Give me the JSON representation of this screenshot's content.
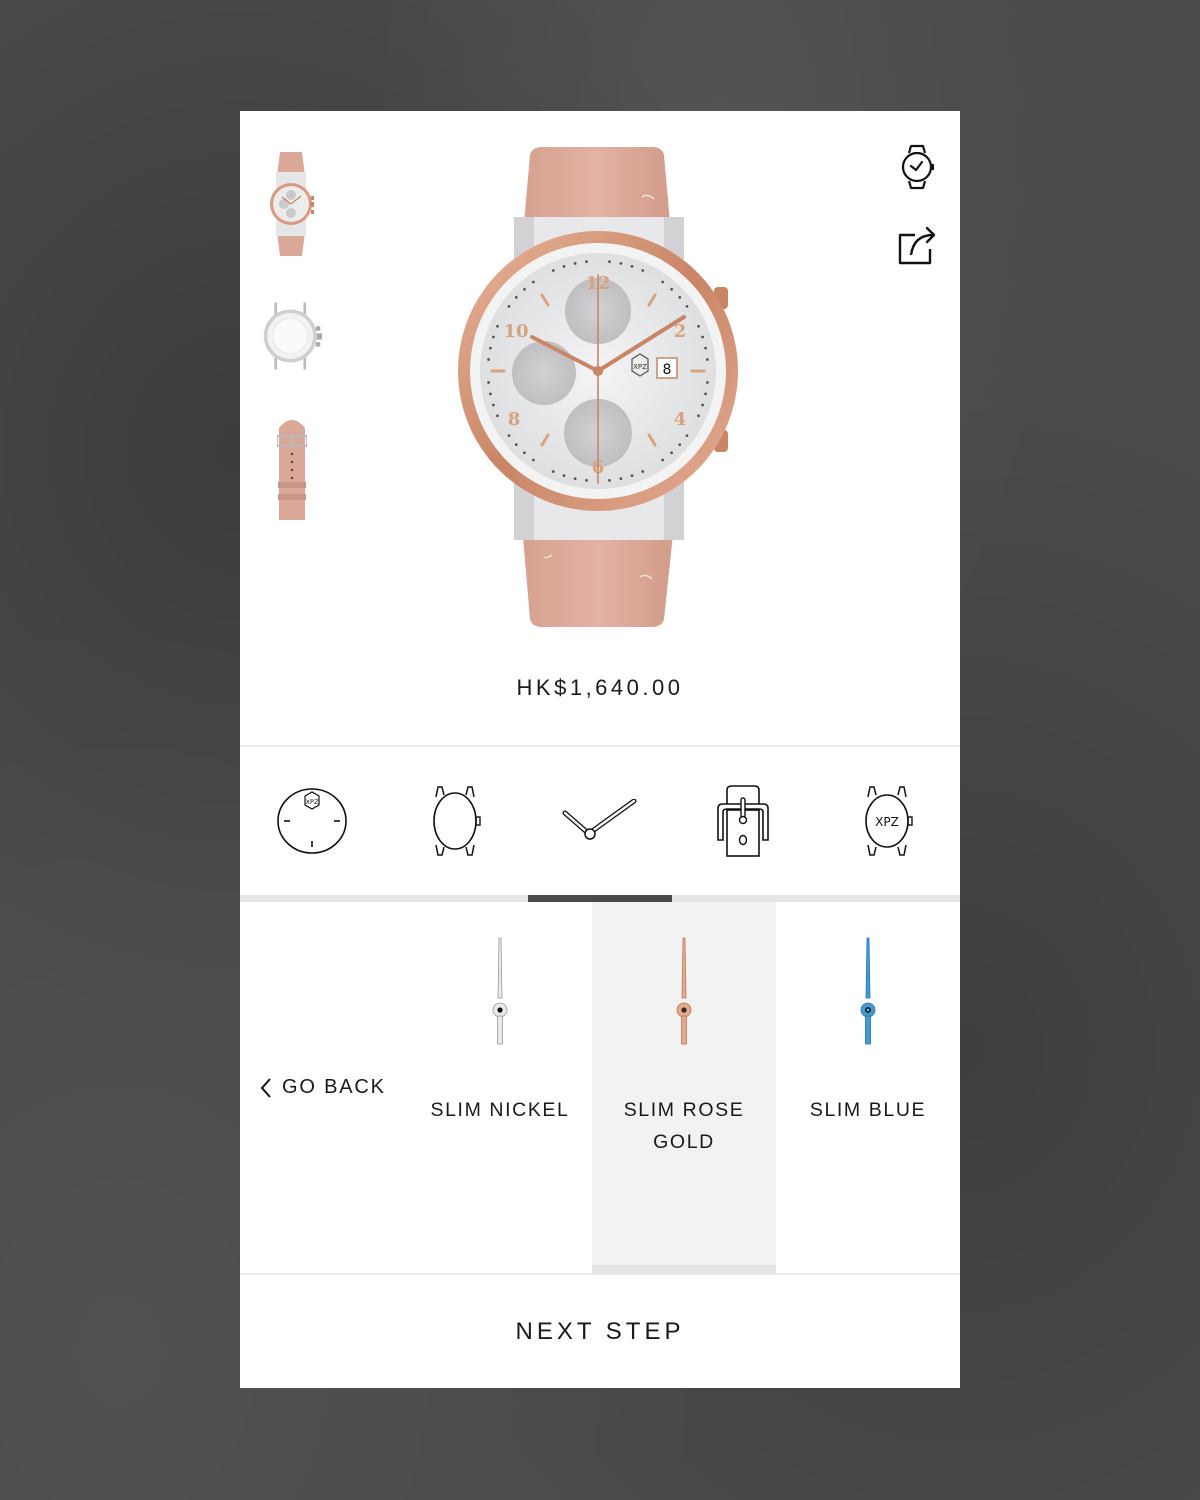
{
  "product": {
    "price": "HK$1,640.00",
    "colors": {
      "strap": "#d9a898",
      "bezel": "#d8997e",
      "dial": "#e9e9ea",
      "accent": "#c98566"
    },
    "main_image": "watch-front-rose-gold-chronograph",
    "dial_text": {
      "logo": "XPZ",
      "date": "8",
      "numerals": [
        "12",
        "2",
        "4",
        "6",
        "8",
        "10"
      ]
    }
  },
  "thumbnails": [
    {
      "name": "front-view",
      "icon": "watch-front-thumbnail"
    },
    {
      "name": "back-view",
      "icon": "watch-back-thumbnail"
    },
    {
      "name": "strap-view",
      "icon": "strap-thumbnail"
    }
  ],
  "top_actions": [
    {
      "name": "watch-view",
      "icon": "watch-icon"
    },
    {
      "name": "share",
      "icon": "share-icon"
    }
  ],
  "steps": [
    {
      "name": "dial",
      "icon": "dial-icon",
      "logo_text": "XPZ"
    },
    {
      "name": "case",
      "icon": "case-icon"
    },
    {
      "name": "hands",
      "icon": "hands-icon",
      "active": true
    },
    {
      "name": "strap",
      "icon": "strap-buckle-icon"
    },
    {
      "name": "engraving",
      "icon": "engraved-case-icon",
      "logo_text": "XPZ"
    }
  ],
  "options": {
    "go_back": "GO BACK",
    "items": [
      {
        "label": "SLIM NICKEL",
        "color": "#eceae6",
        "selected": false
      },
      {
        "label": "SLIM ROSE GOLD",
        "color": "#e4a98c",
        "selected": true
      },
      {
        "label": "SLIM BLUE",
        "color": "#3f9ad6",
        "selected": false
      }
    ]
  },
  "footer": {
    "next_step": "NEXT STEP"
  }
}
